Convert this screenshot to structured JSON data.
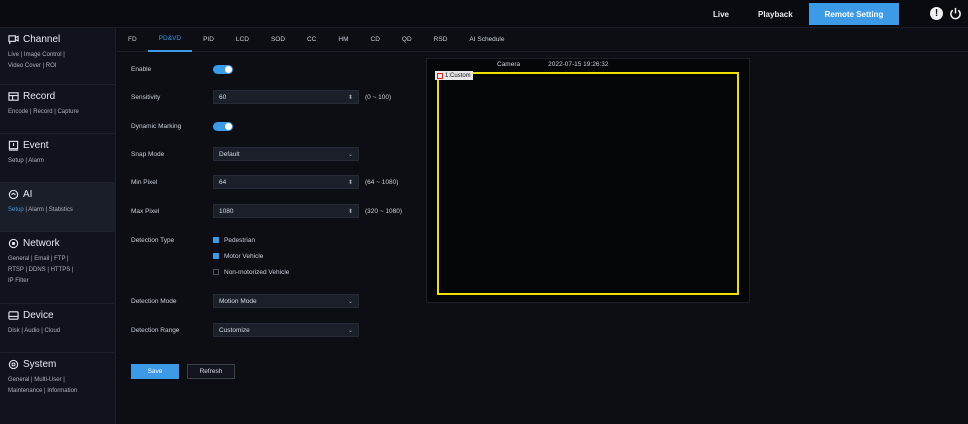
{
  "topbar": {
    "live": "Live",
    "playback": "Playback",
    "remote_setting": "Remote Setting"
  },
  "sidebar": [
    {
      "title": "Channel",
      "icon": "channel-icon",
      "links": [
        "Live | Image Control |",
        "Video Cover | ROI"
      ]
    },
    {
      "title": "Record",
      "icon": "record-icon",
      "links": [
        "Encode | Record | Capture"
      ]
    },
    {
      "title": "Event",
      "icon": "event-icon",
      "links": [
        "Setup | Alarm"
      ]
    },
    {
      "title": "AI",
      "icon": "ai-icon",
      "links_active": "Setup",
      "links_rest": " | Alarm | Statistics"
    },
    {
      "title": "Network",
      "icon": "network-icon",
      "links": [
        "General | Email | FTP |",
        "RTSP | DDNS | HTTPS |",
        "IP Filter"
      ]
    },
    {
      "title": "Device",
      "icon": "device-icon",
      "links": [
        "Disk | Audio | Cloud"
      ]
    },
    {
      "title": "System",
      "icon": "system-icon",
      "links": [
        "General | Multi-User |",
        "Maintenance | Information"
      ]
    }
  ],
  "tabs": [
    "FD",
    "PD&VD",
    "PID",
    "LCD",
    "SOD",
    "CC",
    "HM",
    "CD",
    "QD",
    "RSD",
    "AI Schedule"
  ],
  "active_tab": "PD&VD",
  "form": {
    "enable_label": "Enable",
    "enable_on": true,
    "sensitivity_label": "Sensitivity",
    "sensitivity_value": "60",
    "sensitivity_range": "(0 ~ 100)",
    "dynamic_marking_label": "Dynamic Marking",
    "dynamic_marking_on": true,
    "snap_mode_label": "Snap Mode",
    "snap_mode_value": "Default",
    "min_pixel_label": "Min Pixel",
    "min_pixel_value": "64",
    "min_pixel_range": "(64 ~ 1080)",
    "max_pixel_label": "Max Pixel",
    "max_pixel_value": "1080",
    "max_pixel_range": "(320 ~ 1080)",
    "detection_type_label": "Detection Type",
    "detection_types": [
      {
        "label": "Pedestrian",
        "checked": true
      },
      {
        "label": "Motor Vehicle",
        "checked": true
      },
      {
        "label": "Non-motorized Vehicle",
        "checked": false
      }
    ],
    "detection_mode_label": "Detection Mode",
    "detection_mode_value": "Motion Mode",
    "detection_range_label": "Detection Range",
    "detection_range_value": "Customize",
    "save_label": "Save",
    "refresh_label": "Refresh"
  },
  "video": {
    "camera_label": "Camera",
    "timestamp": "2022-07-15 19:26:32",
    "zone_tag": "1:Custom",
    "zone_color": "#f0e000"
  },
  "colors": {
    "accent": "#3d9ae6",
    "background": "#0c0e14"
  }
}
